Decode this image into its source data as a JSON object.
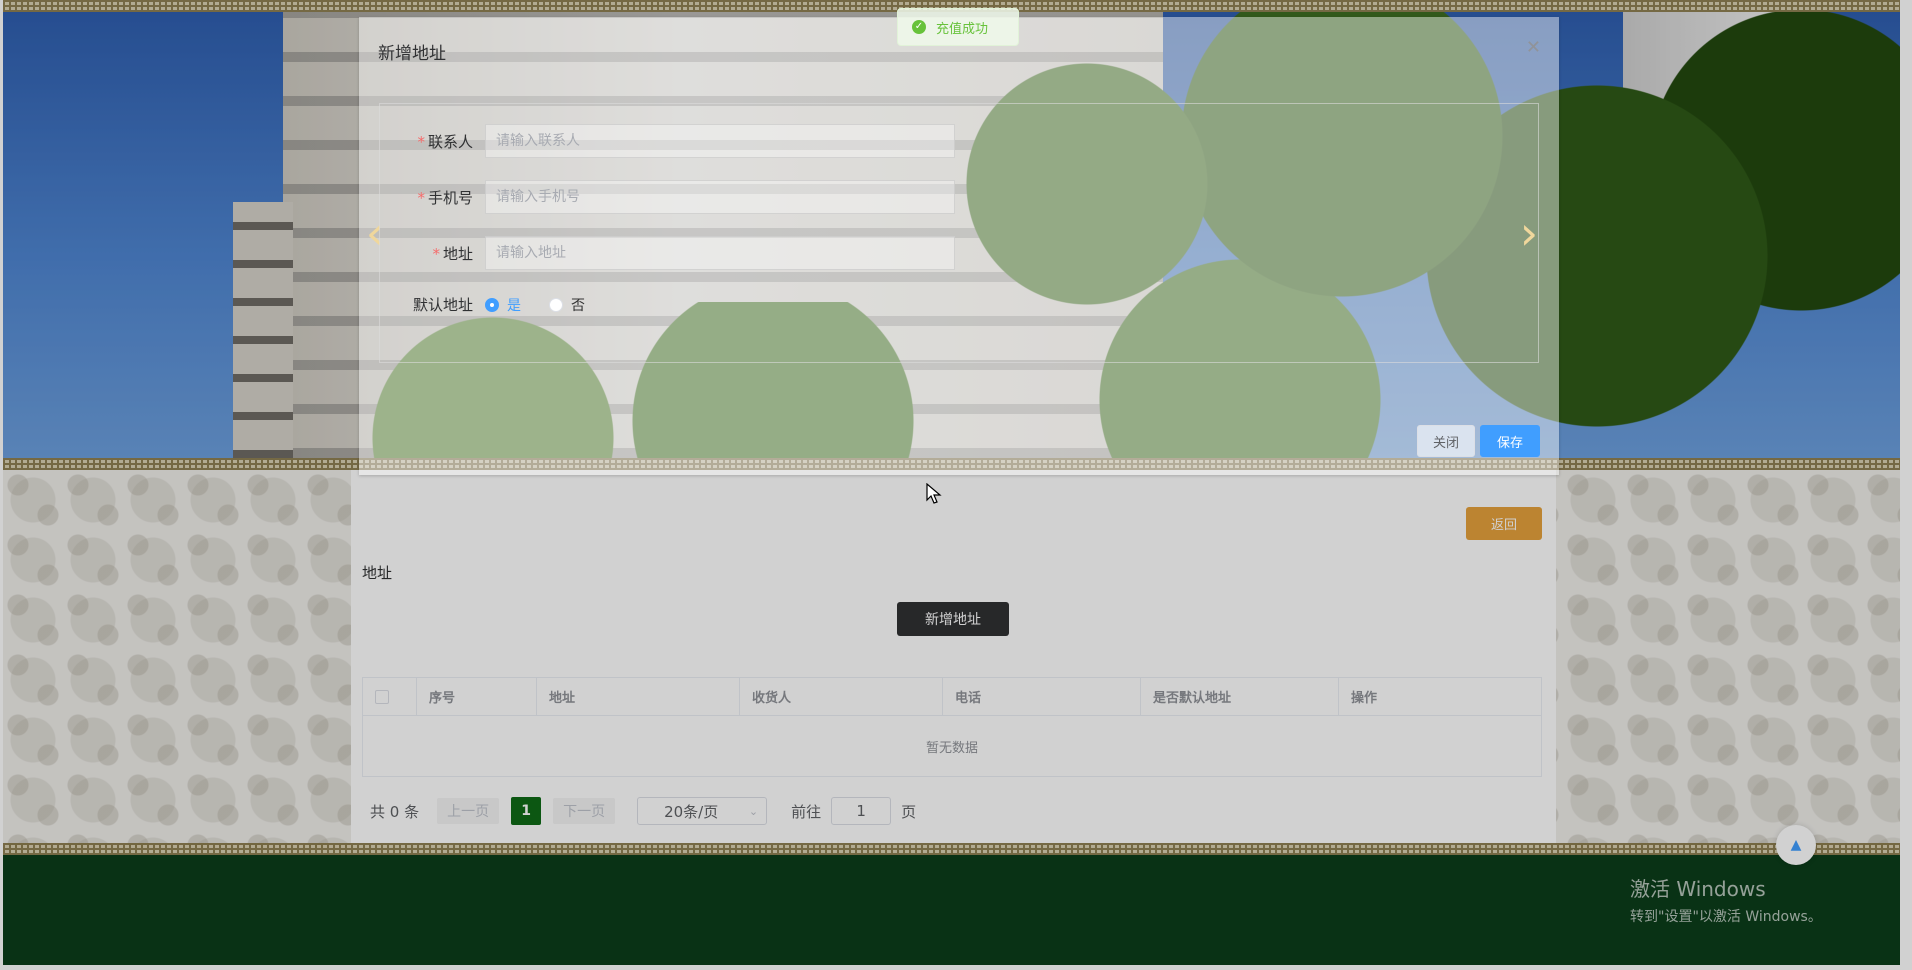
{
  "toast": {
    "message": "充值成功",
    "icon": "check-circle-icon"
  },
  "dialog": {
    "title": "新增地址",
    "close_icon": "close-icon",
    "fields": {
      "contact": {
        "label": "联系人",
        "placeholder": "请输入联系人",
        "required": true
      },
      "phone": {
        "label": "手机号",
        "placeholder": "请输入手机号",
        "required": true
      },
      "address": {
        "label": "地址",
        "placeholder": "请输入地址",
        "required": true
      },
      "default": {
        "label": "默认地址",
        "options": [
          "是",
          "否"
        ],
        "selected": "是"
      }
    },
    "buttons": {
      "close": "关闭",
      "save": "保存"
    }
  },
  "carousel": {
    "prev_icon": "chevron-left-icon",
    "next_icon": "chevron-right-icon"
  },
  "page": {
    "back_button": "返回",
    "section_title": "地址",
    "add_button": "新增地址",
    "table": {
      "columns": [
        "序号",
        "地址",
        "收货人",
        "电话",
        "是否默认地址",
        "操作"
      ],
      "empty_text": "暂无数据"
    },
    "pagination": {
      "total": "共 0 条",
      "prev": "上一页",
      "current_page": "1",
      "next": "下一页",
      "page_size": "20条/页",
      "goto_label": "前往",
      "goto_value": "1",
      "page_suffix": "页"
    }
  },
  "watermark": {
    "line1": "激活 Windows",
    "line2": "转到\"设置\"以激活 Windows。"
  },
  "colors": {
    "primary": "#409eff",
    "warning": "#e6a23c",
    "footer": "#0b3d1a",
    "current_page": "#0f6b17"
  }
}
